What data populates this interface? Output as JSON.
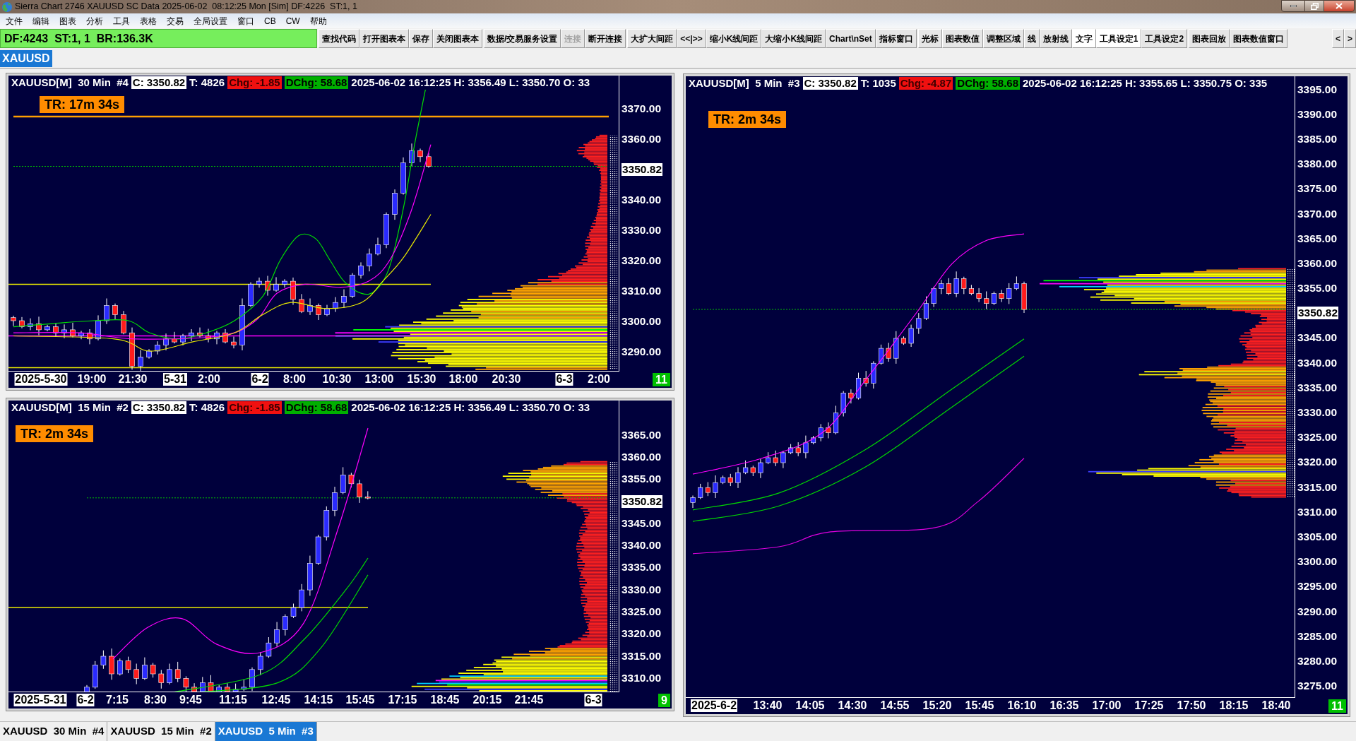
{
  "window": {
    "title": "Sierra Chart 2746 XAUUSD SC Data 2025-06-02  08:12:25 Mon [Sim] DF:4226  ST:1, 1"
  },
  "menu": [
    "文件",
    "编辑",
    "图表",
    "分析",
    "工具",
    "表格",
    "交易",
    "全局设置",
    "窗口",
    "CB",
    "CW",
    "帮助"
  ],
  "status": "DF:4243  ST:1, 1  BR:136.3K",
  "toolbar": {
    "groups": [
      [
        {
          "label": "查找代码",
          "pressed": false,
          "disabled": false
        },
        {
          "label": "打开图表本",
          "pressed": false,
          "disabled": false
        },
        {
          "label": "保存",
          "pressed": false,
          "disabled": false
        },
        {
          "label": "关闭图表本",
          "pressed": false,
          "disabled": false
        }
      ],
      [
        {
          "label": "数据/交易服务设置",
          "pressed": false,
          "disabled": false
        },
        {
          "label": "连接",
          "pressed": false,
          "disabled": true
        },
        {
          "label": "断开连接",
          "pressed": false,
          "disabled": false
        }
      ],
      [
        {
          "label": "大扩大间距",
          "pressed": false,
          "disabled": false
        },
        {
          "label": "<<|>>",
          "pressed": false,
          "disabled": false
        },
        {
          "label": "缩小K线间距",
          "pressed": false,
          "disabled": false
        },
        {
          "label": "大缩小K线间距",
          "pressed": false,
          "disabled": false
        },
        {
          "label": "Chart\\nSet",
          "pressed": false,
          "disabled": false
        },
        {
          "label": "指标窗口",
          "pressed": false,
          "disabled": false
        }
      ],
      [
        {
          "label": "光标",
          "pressed": false,
          "disabled": false
        },
        {
          "label": "图表数值",
          "pressed": false,
          "disabled": false
        },
        {
          "label": "调整区域",
          "pressed": false,
          "disabled": false
        },
        {
          "label": "线",
          "pressed": false,
          "disabled": false
        },
        {
          "label": "放射线",
          "pressed": false,
          "disabled": false
        },
        {
          "label": "文字",
          "pressed": true,
          "disabled": false
        },
        {
          "label": "工具设定1",
          "pressed": true,
          "disabled": false
        },
        {
          "label": "工具设定2",
          "pressed": false,
          "disabled": false
        }
      ],
      [
        {
          "label": "图表回放",
          "pressed": false,
          "disabled": false
        },
        {
          "label": "图表数值窗口",
          "pressed": false,
          "disabled": false
        }
      ],
      [
        {
          "label": "<",
          "pressed": false,
          "disabled": false
        },
        {
          "label": ">",
          "pressed": false,
          "disabled": false
        }
      ]
    ]
  },
  "chartbook_tabs": [
    {
      "label": "XAUUSD",
      "selected": true
    }
  ],
  "charts": [
    {
      "header": {
        "symbol": "XAUUSD[M]  30 Min  #4",
        "close": "C: 3350.82",
        "trades": "T: 4826",
        "change": "Chg: -1.85",
        "daily_change": "DChg: 58.68",
        "info": "2025-06-02 16:12:25 H: 3356.49 L: 3350.70 O: 33"
      },
      "timer": "TR: 17m 34s",
      "price_axis": [
        {
          "label": "3370.00",
          "kind": "tick"
        },
        {
          "label": "3360.00",
          "kind": "tick"
        },
        {
          "label": "3350.82",
          "kind": "current"
        },
        {
          "label": "3340.00",
          "kind": "tick"
        },
        {
          "label": "3330.00",
          "kind": "tick"
        },
        {
          "label": "3320.00",
          "kind": "tick"
        },
        {
          "label": "3310.00",
          "kind": "tick"
        },
        {
          "label": "3300.00",
          "kind": "tick"
        },
        {
          "label": "3290.00",
          "kind": "tick"
        }
      ],
      "time_axis": [
        {
          "label": "2025-5-30",
          "kind": "date"
        },
        {
          "label": "19:00",
          "kind": "time"
        },
        {
          "label": "21:30",
          "kind": "time"
        },
        {
          "label": "5-31",
          "kind": "date"
        },
        {
          "label": "2:00",
          "kind": "time"
        },
        {
          "label": "6-2",
          "kind": "date"
        },
        {
          "label": "8:00",
          "kind": "time"
        },
        {
          "label": "10:30",
          "kind": "time"
        },
        {
          "label": "13:00",
          "kind": "time"
        },
        {
          "label": "15:30",
          "kind": "time"
        },
        {
          "label": "18:00",
          "kind": "time"
        },
        {
          "label": "20:30",
          "kind": "time"
        },
        {
          "label": "6-3",
          "kind": "date"
        },
        {
          "label": "2:00",
          "kind": "time"
        }
      ],
      "bar_count": "11"
    },
    {
      "header": {
        "symbol": "XAUUSD[M]  15 Min  #2",
        "close": "C: 3350.82",
        "trades": "T: 4826",
        "change": "Chg: -1.85",
        "daily_change": "DChg: 58.68",
        "info": "2025-06-02 16:12:25 H: 3356.49 L: 3350.70 O: 33"
      },
      "timer": "TR: 2m 34s",
      "price_axis": [
        {
          "label": "3365.00",
          "kind": "tick"
        },
        {
          "label": "3360.00",
          "kind": "tick"
        },
        {
          "label": "3355.00",
          "kind": "tick"
        },
        {
          "label": "3350.82",
          "kind": "current"
        },
        {
          "label": "3345.00",
          "kind": "tick"
        },
        {
          "label": "3340.00",
          "kind": "tick"
        },
        {
          "label": "3335.00",
          "kind": "tick"
        },
        {
          "label": "3330.00",
          "kind": "tick"
        },
        {
          "label": "3325.00",
          "kind": "tick"
        },
        {
          "label": "3320.00",
          "kind": "tick"
        },
        {
          "label": "3315.00",
          "kind": "tick"
        },
        {
          "label": "3310.00",
          "kind": "tick"
        }
      ],
      "time_axis": [
        {
          "label": "2025-5-31",
          "kind": "date"
        },
        {
          "label": "6-2",
          "kind": "date"
        },
        {
          "label": "7:15",
          "kind": "time"
        },
        {
          "label": "8:30",
          "kind": "time"
        },
        {
          "label": "9:45",
          "kind": "time"
        },
        {
          "label": "11:15",
          "kind": "time"
        },
        {
          "label": "12:45",
          "kind": "time"
        },
        {
          "label": "14:15",
          "kind": "time"
        },
        {
          "label": "15:45",
          "kind": "time"
        },
        {
          "label": "17:15",
          "kind": "time"
        },
        {
          "label": "18:45",
          "kind": "time"
        },
        {
          "label": "20:15",
          "kind": "time"
        },
        {
          "label": "21:45",
          "kind": "time"
        },
        {
          "label": "6-3",
          "kind": "date"
        }
      ],
      "bar_count": "9"
    },
    {
      "header": {
        "symbol": "XAUUSD[M]  5 Min  #3",
        "close": "C: 3350.82",
        "trades": "T: 1035",
        "change": "Chg: -4.87",
        "daily_change": "DChg: 58.68",
        "info": "2025-06-02 16:12:25 H: 3355.65 L: 3350.75 O: 335"
      },
      "timer": "TR: 2m 34s",
      "price_axis": [
        {
          "label": "3395.00",
          "kind": "tick"
        },
        {
          "label": "3390.00",
          "kind": "tick"
        },
        {
          "label": "3385.00",
          "kind": "tick"
        },
        {
          "label": "3380.00",
          "kind": "tick"
        },
        {
          "label": "3375.00",
          "kind": "tick"
        },
        {
          "label": "3370.00",
          "kind": "tick"
        },
        {
          "label": "3365.00",
          "kind": "tick"
        },
        {
          "label": "3360.00",
          "kind": "tick"
        },
        {
          "label": "3355.00",
          "kind": "tick"
        },
        {
          "label": "3350.82",
          "kind": "current"
        },
        {
          "label": "3345.00",
          "kind": "tick"
        },
        {
          "label": "3340.00",
          "kind": "tick"
        },
        {
          "label": "3335.00",
          "kind": "tick"
        },
        {
          "label": "3330.00",
          "kind": "tick"
        },
        {
          "label": "3325.00",
          "kind": "tick"
        },
        {
          "label": "3320.00",
          "kind": "tick"
        },
        {
          "label": "3315.00",
          "kind": "tick"
        },
        {
          "label": "3310.00",
          "kind": "tick"
        },
        {
          "label": "3305.00",
          "kind": "tick"
        },
        {
          "label": "3300.00",
          "kind": "tick"
        },
        {
          "label": "3295.00",
          "kind": "tick"
        },
        {
          "label": "3290.00",
          "kind": "tick"
        },
        {
          "label": "3285.00",
          "kind": "tick"
        },
        {
          "label": "3280.00",
          "kind": "tick"
        },
        {
          "label": "3275.00",
          "kind": "tick"
        }
      ],
      "time_axis": [
        {
          "label": "2025-6-2",
          "kind": "date"
        },
        {
          "label": "13:40",
          "kind": "time"
        },
        {
          "label": "14:05",
          "kind": "time"
        },
        {
          "label": "14:30",
          "kind": "time"
        },
        {
          "label": "14:55",
          "kind": "time"
        },
        {
          "label": "15:20",
          "kind": "time"
        },
        {
          "label": "15:45",
          "kind": "time"
        },
        {
          "label": "16:10",
          "kind": "time"
        },
        {
          "label": "16:35",
          "kind": "time"
        },
        {
          "label": "17:00",
          "kind": "time"
        },
        {
          "label": "17:25",
          "kind": "time"
        },
        {
          "label": "17:50",
          "kind": "time"
        },
        {
          "label": "18:15",
          "kind": "time"
        },
        {
          "label": "18:40",
          "kind": "time"
        }
      ],
      "bar_count": "11"
    }
  ],
  "chart_tabs": [
    {
      "label": "XAUUSD  30 Min  #4",
      "selected": false
    },
    {
      "label": "XAUUSD  15 Min  #2",
      "selected": false
    },
    {
      "label": "XAUUSD  5 Min  #3",
      "selected": true
    }
  ]
}
